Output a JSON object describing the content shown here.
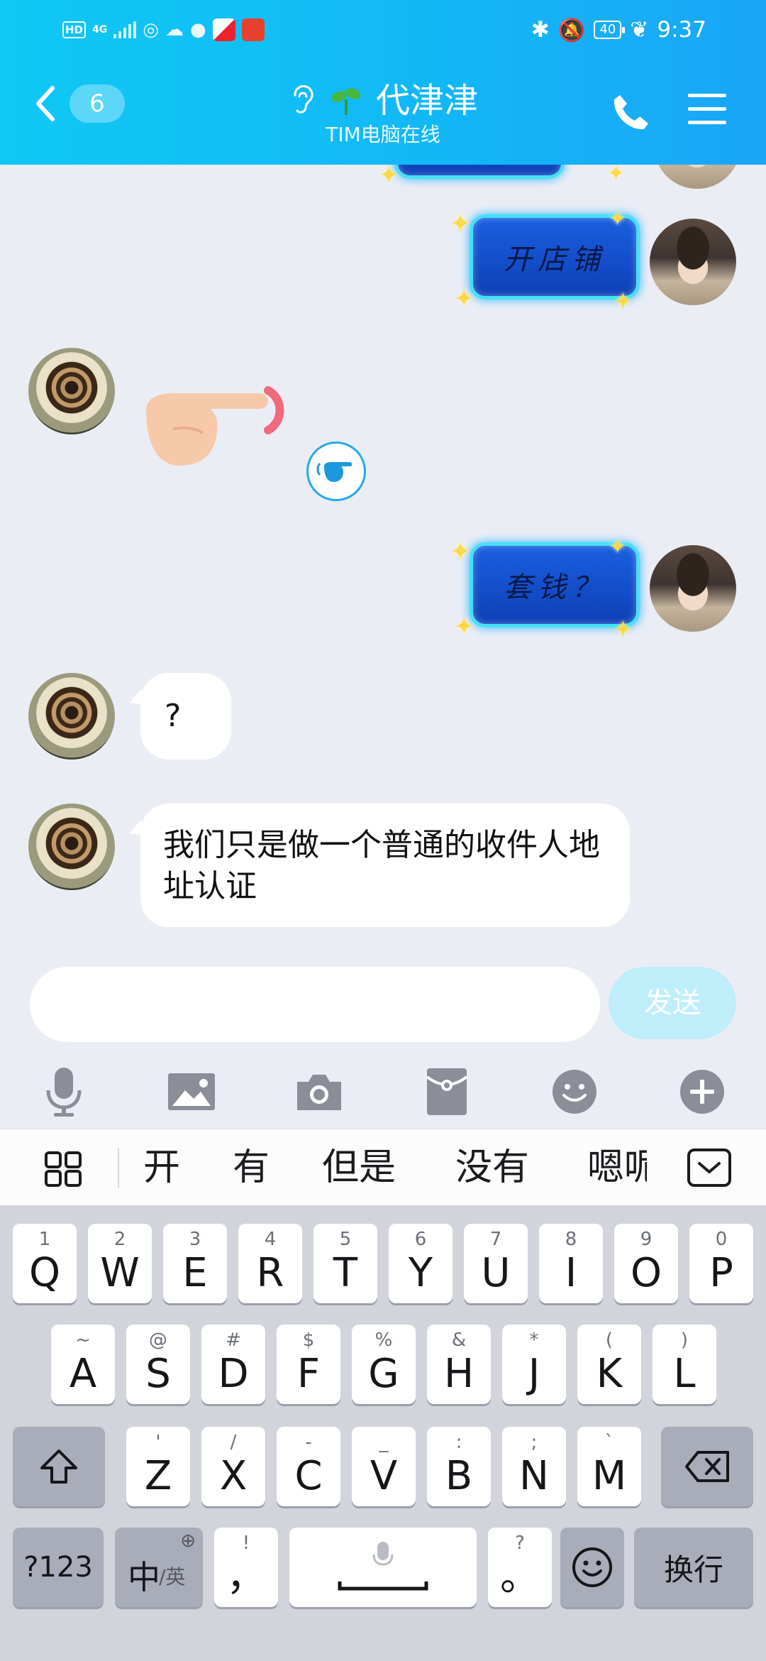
{
  "status_bar": {
    "left_indicators": {
      "hd": "HD",
      "network": "4G"
    },
    "battery": "40",
    "time": "9:37"
  },
  "header": {
    "back_count": "6",
    "contact_name": "代津津",
    "status": "TIM电脑在线"
  },
  "messages": [
    {
      "side": "right",
      "type": "sticker",
      "text": "开店铺"
    },
    {
      "side": "left",
      "type": "emoji",
      "emoji": "pointing-finger"
    },
    {
      "side": "right",
      "type": "sticker",
      "text": "套钱？"
    },
    {
      "side": "left",
      "type": "text",
      "text": "?"
    },
    {
      "side": "left",
      "type": "text",
      "text": "我们只是做一个普通的收件人地址认证"
    }
  ],
  "composer": {
    "placeholder": "",
    "send_label": "发送"
  },
  "toolbar_icons": [
    "microphone-icon",
    "image-icon",
    "camera-icon",
    "red-packet-icon",
    "emoji-icon",
    "plus-icon"
  ],
  "keyboard": {
    "candidates": [
      "开",
      "有",
      "但是",
      "没有",
      "嗯呢"
    ],
    "row1": [
      {
        "c": "Q",
        "h": "1"
      },
      {
        "c": "W",
        "h": "2"
      },
      {
        "c": "E",
        "h": "3"
      },
      {
        "c": "R",
        "h": "4"
      },
      {
        "c": "T",
        "h": "5"
      },
      {
        "c": "Y",
        "h": "6"
      },
      {
        "c": "U",
        "h": "7"
      },
      {
        "c": "I",
        "h": "8"
      },
      {
        "c": "O",
        "h": "9"
      },
      {
        "c": "P",
        "h": "0"
      }
    ],
    "row2": [
      {
        "c": "A",
        "h": "~"
      },
      {
        "c": "S",
        "h": "@"
      },
      {
        "c": "D",
        "h": "#"
      },
      {
        "c": "F",
        "h": "$"
      },
      {
        "c": "G",
        "h": "%"
      },
      {
        "c": "H",
        "h": "&"
      },
      {
        "c": "J",
        "h": "*"
      },
      {
        "c": "K",
        "h": "("
      },
      {
        "c": "L",
        "h": ")"
      }
    ],
    "row3": [
      {
        "c": "Z",
        "h": "'"
      },
      {
        "c": "X",
        "h": "/"
      },
      {
        "c": "C",
        "h": "-"
      },
      {
        "c": "V",
        "h": "_"
      },
      {
        "c": "B",
        "h": ":"
      },
      {
        "c": "N",
        "h": ";"
      },
      {
        "c": "M",
        "h": "`"
      }
    ],
    "numbers_key": "?123",
    "lang_key_main": "中",
    "lang_key_sub": "/英",
    "comma_key": {
      "c": "，",
      "h": "!"
    },
    "period_key": {
      "c": "。",
      "h": "?"
    },
    "enter_key": "换行"
  }
}
